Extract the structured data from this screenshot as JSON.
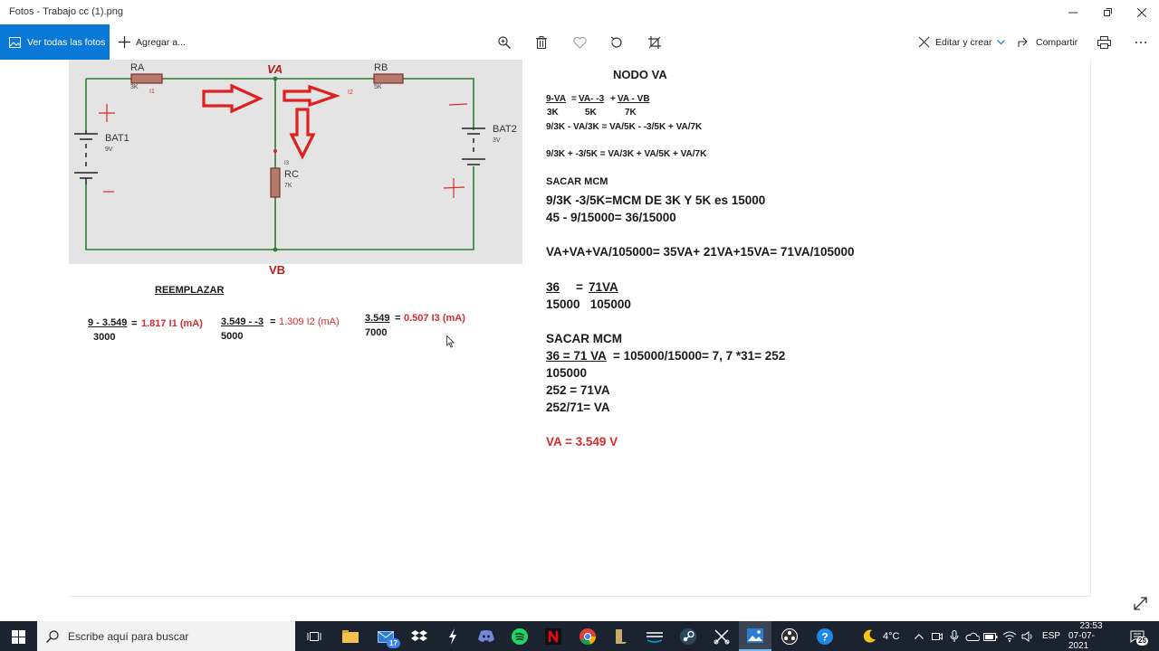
{
  "window": {
    "title": "Fotos - Trabajo cc (1).png"
  },
  "toolbar": {
    "see_all": "Ver todas las fotos",
    "add_to": "Agregar a...",
    "edit_create": "Editar y crear",
    "share": "Compartir",
    "icons": [
      "zoom-icon",
      "delete-icon",
      "favorite-icon",
      "rotate-icon",
      "crop-icon",
      "print-icon",
      "more-icon"
    ]
  },
  "circuit": {
    "ra": {
      "name": "RA",
      "value": "3K",
      "current": "I1"
    },
    "rb": {
      "name": "RB",
      "value": "5K"
    },
    "rc": {
      "name": "RC",
      "value": "7K",
      "current": "I3"
    },
    "i2": "I2",
    "bat1": {
      "name": "BAT1",
      "value": "9V"
    },
    "bat2": {
      "name": "BAT2",
      "value": "3V"
    },
    "node_top": "VA",
    "node_bottom": "VB"
  },
  "replace": {
    "title": "REEMPLAZAR",
    "eq1": {
      "num": "9 - 3.549",
      "den": "3000",
      "eq": "=",
      "result": "1.817 I1 (mA)"
    },
    "eq2": {
      "num": "3.549 - -3",
      "den": "5000",
      "eq": "=",
      "result": "1.309 I2 (mA)"
    },
    "eq3": {
      "num": "3.549",
      "den": "7000",
      "eq": "=",
      "result": "0.507 I3 (mA)"
    }
  },
  "nodo": {
    "title": "NODO VA",
    "frac_line": {
      "a": "9-VA",
      "eq": "=",
      "b": "VA- -3",
      "plus1": "+",
      "c": "VA - VB"
    },
    "frac_dens": {
      "a": "3K",
      "b": "5K",
      "c": "7K"
    },
    "line2": "9/3K - VA/3K = VA/5K - -3/5K + VA/7K",
    "line3": "9/3K + -3/5K = VA/3K + VA/5K + VA/7K",
    "sacar1": "SACAR MCM",
    "line4": "9/3K -3/5K=MCM DE 3K Y 5K es 15000",
    "line5": "45 - 9/15000= 36/15000",
    "line6": "VA+VA+VA/105000= 35VA+ 21VA+15VA= 71VA/105000",
    "line7_a": "36",
    "line7_eq": "=",
    "line7_b": "71VA",
    "line8": "15000   105000",
    "sacar2": "SACAR MCM",
    "line9_a": "36 = 71 VA",
    "line9_b": "= 105000/15000= 7, 7 *31= 252",
    "line10": "105000",
    "line11": "252 = 71VA",
    "line12": "252/71= VA",
    "result": "VA = 3.549 V"
  },
  "taskbar": {
    "search_placeholder": "Escribe aquí para buscar",
    "mail_badge": "17",
    "temperature": "4°C",
    "language": "ESP",
    "time": "23:53",
    "date": "07-07-2021",
    "notif_count": "25"
  },
  "colors": {
    "accent": "#0a78d7",
    "red": "#d92b2b",
    "wire": "#2e7d32",
    "taskbar": "#1c2330"
  }
}
